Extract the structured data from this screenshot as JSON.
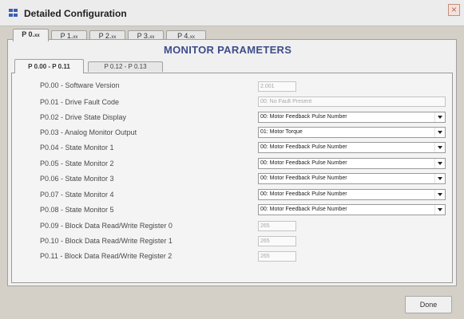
{
  "window": {
    "title": "Detailed Configuration"
  },
  "outer_tabs": [
    {
      "prefix": "P 0.",
      "suffix": "xx"
    },
    {
      "prefix": "P 1.",
      "suffix": "xx"
    },
    {
      "prefix": "P 2.",
      "suffix": "xx"
    },
    {
      "prefix": "P 3.",
      "suffix": "xx"
    },
    {
      "prefix": "P 4.",
      "suffix": "xx"
    }
  ],
  "heading": "MONITOR PARAMETERS",
  "inner_tabs": [
    {
      "label": "P 0.00 - P 0.11"
    },
    {
      "label": "P 0.12 - P 0.13"
    }
  ],
  "params": [
    {
      "label": "P0.00 - Software Version",
      "value": "2.001"
    },
    {
      "label": "P0.01 - Drive Fault Code",
      "value": "00: No Fault Present"
    },
    {
      "label": "P0.02 - Drive State Display",
      "value": "00: Motor Feedback Pulse Number"
    },
    {
      "label": "P0.03 - Analog Monitor Output",
      "value": "01: Motor Torque"
    },
    {
      "label": "P0.04 - State Monitor 1",
      "value": "00: Motor Feedback Pulse Number"
    },
    {
      "label": "P0.05 - State Monitor 2",
      "value": "00: Motor Feedback Pulse Number"
    },
    {
      "label": "P0.06 - State Monitor 3",
      "value": "00: Motor Feedback Pulse Number"
    },
    {
      "label": "P0.07 - State Monitor 4",
      "value": "00: Motor Feedback Pulse Number"
    },
    {
      "label": "P0.08 - State Monitor 5",
      "value": "00: Motor Feedback Pulse Number"
    },
    {
      "label": "P0.09 - Block Data Read/Write Register 0",
      "value": "265"
    },
    {
      "label": "P0.10 - Block Data Read/Write Register 1",
      "value": "265"
    },
    {
      "label": "P0.11 - Block Data Read/Write Register 2",
      "value": "265"
    }
  ],
  "buttons": {
    "done": "Done"
  }
}
